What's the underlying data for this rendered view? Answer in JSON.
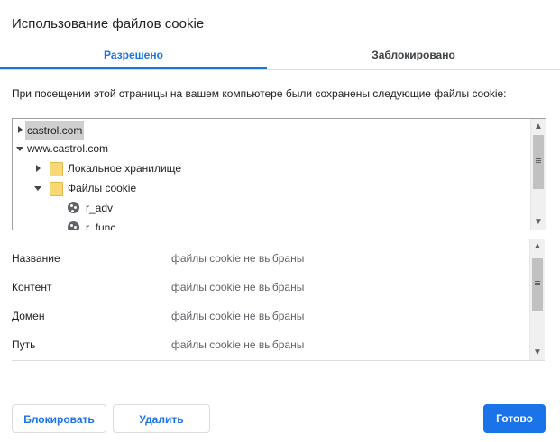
{
  "dialog": {
    "title": "Использование файлов cookie"
  },
  "tabs": [
    {
      "label": "Разрешено",
      "active": true
    },
    {
      "label": "Заблокировано",
      "active": false
    }
  ],
  "description": "При посещении этой страницы на вашем компьютере были сохранены следующие файлы cookie:",
  "tree": {
    "items": [
      {
        "label": "castrol.com",
        "expanded": false,
        "selected": true
      },
      {
        "label": "www.castrol.com",
        "expanded": true
      },
      {
        "label": "Локальное хранилище",
        "expanded": false,
        "icon": "folder-icon"
      },
      {
        "label": "Файлы cookie",
        "expanded": true,
        "icon": "folder-open-icon"
      },
      {
        "label": "r_adv",
        "icon": "cookie-icon"
      },
      {
        "label": "r_func",
        "icon": "cookie-icon"
      }
    ]
  },
  "details": [
    {
      "label": "Название",
      "value": "файлы cookie не выбраны"
    },
    {
      "label": "Контент",
      "value": "файлы cookie не выбраны"
    },
    {
      "label": "Домен",
      "value": "файлы cookie не выбраны"
    },
    {
      "label": "Путь",
      "value": "файлы cookie не выбраны"
    }
  ],
  "buttons": {
    "block": "Блокировать",
    "delete": "Удалить",
    "done": "Готово"
  },
  "colors": {
    "accent": "#1a73e8",
    "selection": "#cfcfcf",
    "folder": "#f8d775"
  }
}
